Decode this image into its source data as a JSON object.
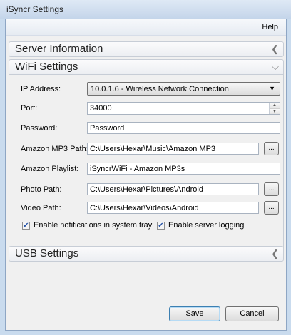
{
  "window": {
    "title": "iSyncr Settings"
  },
  "menu": {
    "help": "Help"
  },
  "sections": {
    "server": {
      "label": "Server Information"
    },
    "wifi": {
      "label": "WiFi Settings"
    },
    "usb": {
      "label": "USB Settings"
    }
  },
  "wifi": {
    "ip_label": "IP Address:",
    "ip_value": "10.0.1.6 - Wireless Network Connection",
    "port_label": "Port:",
    "port_value": "34000",
    "password_label": "Password:",
    "password_value": "Password",
    "amazon_mp3_label": "Amazon MP3 Path:",
    "amazon_mp3_value": "C:\\Users\\Hexar\\Music\\Amazon MP3",
    "amazon_playlist_label": "Amazon Playlist:",
    "amazon_playlist_value": "iSyncrWiFi - Amazon MP3s",
    "photo_label": "Photo Path:",
    "photo_value": "C:\\Users\\Hexar\\Pictures\\Android",
    "video_label": "Video Path:",
    "video_value": "C:\\Users\\Hexar\\Videos\\Android",
    "browse_label": "...",
    "notifications_label": "Enable notifications in system tray",
    "notifications_checked": true,
    "logging_label": "Enable server logging",
    "logging_checked": true
  },
  "buttons": {
    "save": "Save",
    "cancel": "Cancel"
  },
  "icons": {
    "collapsed": "chevron-left-icon",
    "expanded": "chevron-down-icon",
    "dropdown": "triangle-down-icon",
    "check": "checkmark-icon"
  }
}
